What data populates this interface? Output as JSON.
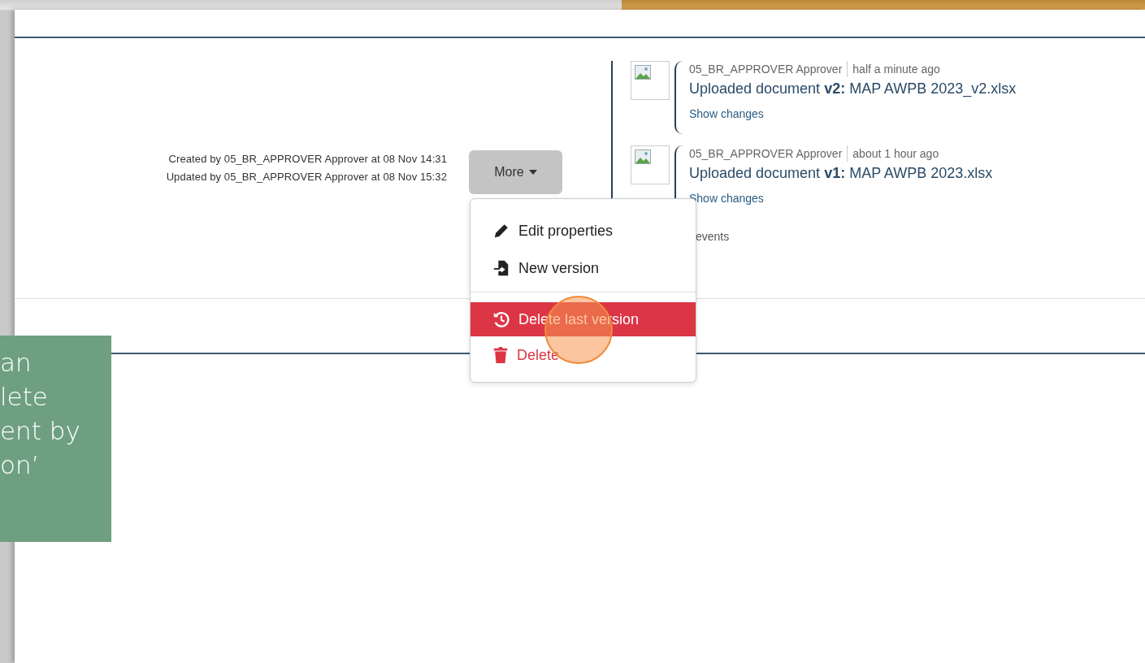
{
  "record": {
    "created": "Created by 05_BR_APPROVER Approver at 08 Nov 14:31",
    "updated": "Updated by 05_BR_APPROVER Approver at 08 Nov 15:32"
  },
  "more_button": {
    "label": "More",
    "expanded": true
  },
  "menu": [
    {
      "label": "Edit properties",
      "kind": "edit",
      "danger": false,
      "highlighted": false
    },
    {
      "label": "New version",
      "kind": "new",
      "danger": false,
      "highlighted": false
    },
    {
      "label": "Delete last version",
      "kind": "history",
      "danger": true,
      "highlighted": true
    },
    {
      "label": "Delete",
      "kind": "trash",
      "danger": true,
      "highlighted": false
    }
  ],
  "timeline": [
    {
      "author": "05_BR_APPROVER Approver",
      "time": "half a minute ago",
      "message": "Uploaded document **v2:** MAP AWPB 2023_v2.xlsx",
      "link": "Show changes"
    },
    {
      "author": "05_BR_APPROVER Approver",
      "time": "about 1 hour ago",
      "message": "Uploaded document **v1:** MAP AWPB 2023.xlsx",
      "link": "Show changes"
    }
  ],
  "timeline_more": "events",
  "callout": {
    "lines": [
      "an",
      "lete",
      "ent by",
      "on’"
    ]
  }
}
